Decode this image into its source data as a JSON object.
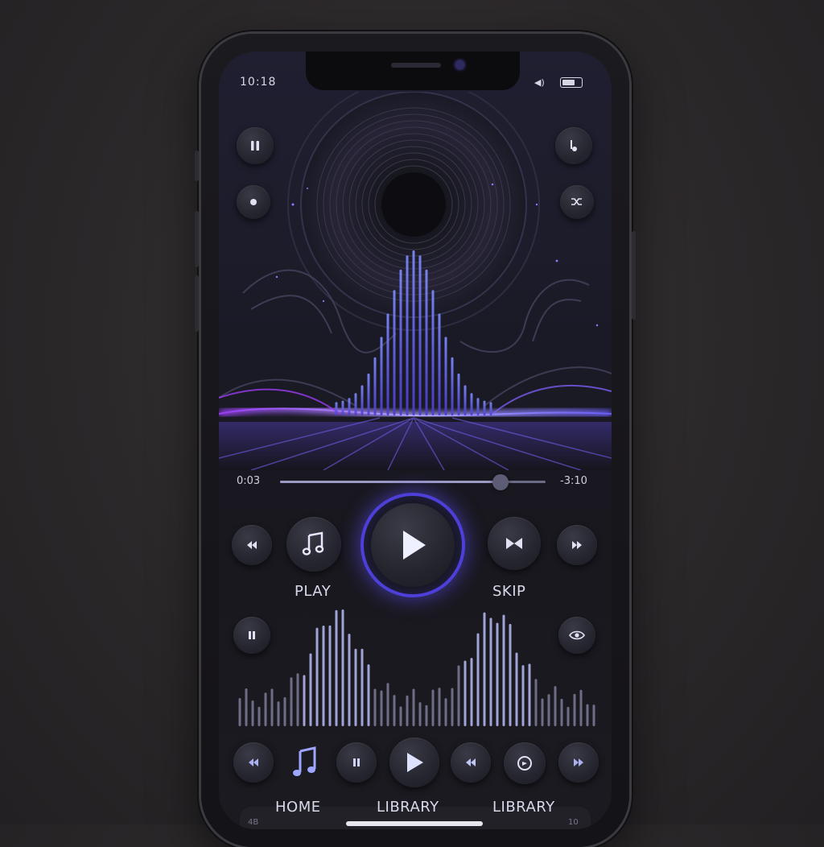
{
  "status": {
    "time": "10:18",
    "signal": "◀)"
  },
  "player": {
    "elapsed": "0:03",
    "remaining": "-3:10",
    "progress": 0.83
  },
  "controls": {
    "play_label": "PLAY",
    "skip_label": "SKIP"
  },
  "nav": {
    "home_label": "HOME",
    "library_label_1": "LIBRARY",
    "library_label_2": "LIBRARY"
  },
  "bottom": {
    "left_text": "4B",
    "right_text": "10"
  },
  "icons": {
    "top_left_1": "pause-icon",
    "top_left_2": "record-icon",
    "top_right_1": "note-icon",
    "top_right_2": "shuffle-icon",
    "eye": "eye-icon"
  },
  "colors": {
    "accent": "#5b4cf0",
    "accent_purple": "#a04cf0",
    "text": "#d8d9ea"
  }
}
